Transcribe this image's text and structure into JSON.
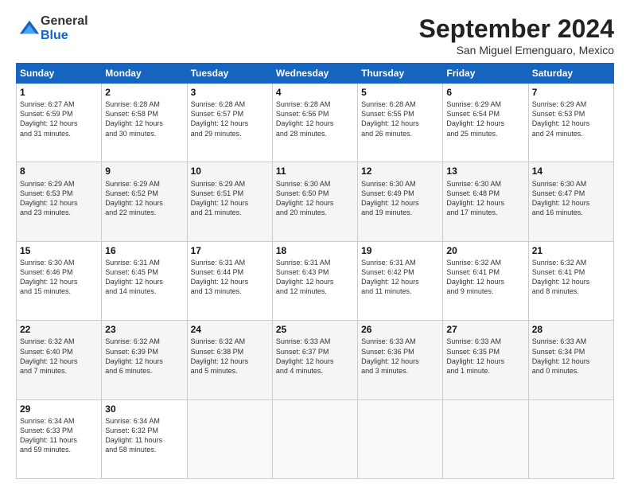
{
  "logo": {
    "general": "General",
    "blue": "Blue"
  },
  "header": {
    "month": "September 2024",
    "location": "San Miguel Emenguaro, Mexico"
  },
  "weekdays": [
    "Sunday",
    "Monday",
    "Tuesday",
    "Wednesday",
    "Thursday",
    "Friday",
    "Saturday"
  ],
  "weeks": [
    [
      {
        "day": "1",
        "lines": [
          "Sunrise: 6:27 AM",
          "Sunset: 6:59 PM",
          "Daylight: 12 hours",
          "and 31 minutes."
        ]
      },
      {
        "day": "2",
        "lines": [
          "Sunrise: 6:28 AM",
          "Sunset: 6:58 PM",
          "Daylight: 12 hours",
          "and 30 minutes."
        ]
      },
      {
        "day": "3",
        "lines": [
          "Sunrise: 6:28 AM",
          "Sunset: 6:57 PM",
          "Daylight: 12 hours",
          "and 29 minutes."
        ]
      },
      {
        "day": "4",
        "lines": [
          "Sunrise: 6:28 AM",
          "Sunset: 6:56 PM",
          "Daylight: 12 hours",
          "and 28 minutes."
        ]
      },
      {
        "day": "5",
        "lines": [
          "Sunrise: 6:28 AM",
          "Sunset: 6:55 PM",
          "Daylight: 12 hours",
          "and 26 minutes."
        ]
      },
      {
        "day": "6",
        "lines": [
          "Sunrise: 6:29 AM",
          "Sunset: 6:54 PM",
          "Daylight: 12 hours",
          "and 25 minutes."
        ]
      },
      {
        "day": "7",
        "lines": [
          "Sunrise: 6:29 AM",
          "Sunset: 6:53 PM",
          "Daylight: 12 hours",
          "and 24 minutes."
        ]
      }
    ],
    [
      {
        "day": "8",
        "lines": [
          "Sunrise: 6:29 AM",
          "Sunset: 6:53 PM",
          "Daylight: 12 hours",
          "and 23 minutes."
        ]
      },
      {
        "day": "9",
        "lines": [
          "Sunrise: 6:29 AM",
          "Sunset: 6:52 PM",
          "Daylight: 12 hours",
          "and 22 minutes."
        ]
      },
      {
        "day": "10",
        "lines": [
          "Sunrise: 6:29 AM",
          "Sunset: 6:51 PM",
          "Daylight: 12 hours",
          "and 21 minutes."
        ]
      },
      {
        "day": "11",
        "lines": [
          "Sunrise: 6:30 AM",
          "Sunset: 6:50 PM",
          "Daylight: 12 hours",
          "and 20 minutes."
        ]
      },
      {
        "day": "12",
        "lines": [
          "Sunrise: 6:30 AM",
          "Sunset: 6:49 PM",
          "Daylight: 12 hours",
          "and 19 minutes."
        ]
      },
      {
        "day": "13",
        "lines": [
          "Sunrise: 6:30 AM",
          "Sunset: 6:48 PM",
          "Daylight: 12 hours",
          "and 17 minutes."
        ]
      },
      {
        "day": "14",
        "lines": [
          "Sunrise: 6:30 AM",
          "Sunset: 6:47 PM",
          "Daylight: 12 hours",
          "and 16 minutes."
        ]
      }
    ],
    [
      {
        "day": "15",
        "lines": [
          "Sunrise: 6:30 AM",
          "Sunset: 6:46 PM",
          "Daylight: 12 hours",
          "and 15 minutes."
        ]
      },
      {
        "day": "16",
        "lines": [
          "Sunrise: 6:31 AM",
          "Sunset: 6:45 PM",
          "Daylight: 12 hours",
          "and 14 minutes."
        ]
      },
      {
        "day": "17",
        "lines": [
          "Sunrise: 6:31 AM",
          "Sunset: 6:44 PM",
          "Daylight: 12 hours",
          "and 13 minutes."
        ]
      },
      {
        "day": "18",
        "lines": [
          "Sunrise: 6:31 AM",
          "Sunset: 6:43 PM",
          "Daylight: 12 hours",
          "and 12 minutes."
        ]
      },
      {
        "day": "19",
        "lines": [
          "Sunrise: 6:31 AM",
          "Sunset: 6:42 PM",
          "Daylight: 12 hours",
          "and 11 minutes."
        ]
      },
      {
        "day": "20",
        "lines": [
          "Sunrise: 6:32 AM",
          "Sunset: 6:41 PM",
          "Daylight: 12 hours",
          "and 9 minutes."
        ]
      },
      {
        "day": "21",
        "lines": [
          "Sunrise: 6:32 AM",
          "Sunset: 6:41 PM",
          "Daylight: 12 hours",
          "and 8 minutes."
        ]
      }
    ],
    [
      {
        "day": "22",
        "lines": [
          "Sunrise: 6:32 AM",
          "Sunset: 6:40 PM",
          "Daylight: 12 hours",
          "and 7 minutes."
        ]
      },
      {
        "day": "23",
        "lines": [
          "Sunrise: 6:32 AM",
          "Sunset: 6:39 PM",
          "Daylight: 12 hours",
          "and 6 minutes."
        ]
      },
      {
        "day": "24",
        "lines": [
          "Sunrise: 6:32 AM",
          "Sunset: 6:38 PM",
          "Daylight: 12 hours",
          "and 5 minutes."
        ]
      },
      {
        "day": "25",
        "lines": [
          "Sunrise: 6:33 AM",
          "Sunset: 6:37 PM",
          "Daylight: 12 hours",
          "and 4 minutes."
        ]
      },
      {
        "day": "26",
        "lines": [
          "Sunrise: 6:33 AM",
          "Sunset: 6:36 PM",
          "Daylight: 12 hours",
          "and 3 minutes."
        ]
      },
      {
        "day": "27",
        "lines": [
          "Sunrise: 6:33 AM",
          "Sunset: 6:35 PM",
          "Daylight: 12 hours",
          "and 1 minute."
        ]
      },
      {
        "day": "28",
        "lines": [
          "Sunrise: 6:33 AM",
          "Sunset: 6:34 PM",
          "Daylight: 12 hours",
          "and 0 minutes."
        ]
      }
    ],
    [
      {
        "day": "29",
        "lines": [
          "Sunrise: 6:34 AM",
          "Sunset: 6:33 PM",
          "Daylight: 11 hours",
          "and 59 minutes."
        ]
      },
      {
        "day": "30",
        "lines": [
          "Sunrise: 6:34 AM",
          "Sunset: 6:32 PM",
          "Daylight: 11 hours",
          "and 58 minutes."
        ]
      },
      {
        "day": "",
        "lines": []
      },
      {
        "day": "",
        "lines": []
      },
      {
        "day": "",
        "lines": []
      },
      {
        "day": "",
        "lines": []
      },
      {
        "day": "",
        "lines": []
      }
    ]
  ]
}
